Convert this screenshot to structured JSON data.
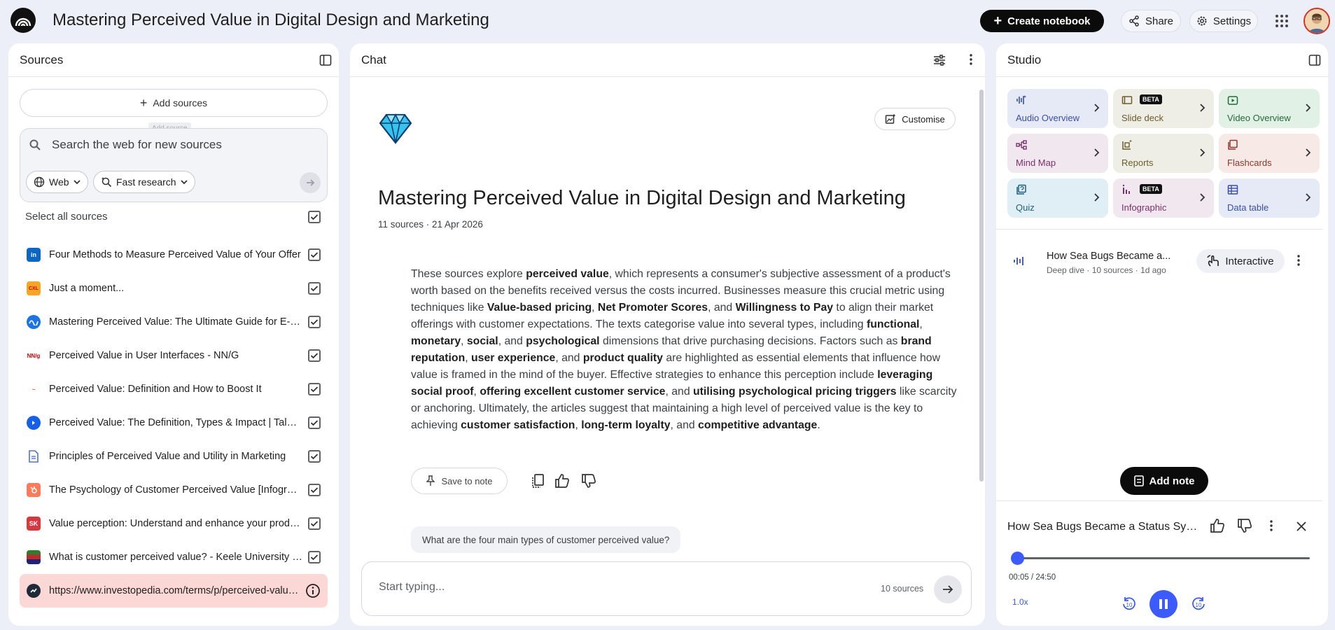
{
  "header": {
    "title": "Mastering Perceived Value in Digital Design and Marketing",
    "create_label": "Create notebook",
    "share_label": "Share",
    "settings_label": "Settings"
  },
  "sources": {
    "panel_title": "Sources",
    "add_label": "Add sources",
    "tooltip": "Add source",
    "search_placeholder": "Search the web for new sources",
    "chip_web": "Web",
    "chip_research": "Fast research",
    "select_all": "Select all sources",
    "items": [
      {
        "title": "Four Methods to Measure Perceived Value of Your Offer",
        "icon": "linkedin-icon",
        "checked": true
      },
      {
        "title": "Just a moment...",
        "icon": "cxl-icon",
        "checked": true
      },
      {
        "title": "Mastering Perceived Value: The Ultimate Guide for E-commerce",
        "icon": "wave-icon",
        "checked": true
      },
      {
        "title": "Perceived Value in User Interfaces - NN/G",
        "icon": "nng-icon",
        "checked": true
      },
      {
        "title": "Perceived Value: Definition and How to Boost It",
        "icon": "script-logo-icon",
        "checked": true
      },
      {
        "title": "Perceived Value: The Definition, Types & Impact | Talon.One",
        "icon": "talon-icon",
        "checked": true
      },
      {
        "title": "Principles of Perceived Value and Utility in Marketing",
        "icon": "document-icon",
        "checked": true
      },
      {
        "title": "The Psychology of Customer Perceived Value [Infographic]",
        "icon": "hubspot-icon",
        "checked": true
      },
      {
        "title": "Value perception: Understand and enhance your product",
        "icon": "sk-icon",
        "checked": true
      },
      {
        "title": "What is customer perceived value? - Keele University - FutureLearn",
        "icon": "keele-icon",
        "checked": true
      }
    ],
    "error_item": "https://www.investopedia.com/terms/p/perceived-value.asp"
  },
  "chat": {
    "panel_title": "Chat",
    "customise_label": "Customise",
    "notebook_title": "Mastering Perceived Value in Digital Design and Marketing",
    "meta": "11 sources · 21 Apr 2026",
    "save_label": "Save to note",
    "user_question": "What are the four main types of customer perceived value?",
    "input_placeholder": "Start typing...",
    "source_count": "10 sources"
  },
  "studio": {
    "panel_title": "Studio",
    "tiles": [
      {
        "label": "Audio Overview",
        "icon": "audio-wave-icon",
        "bg": "#e6eaf7",
        "color": "#3a4ea8"
      },
      {
        "label": "Slide deck",
        "icon": "slides-icon",
        "bg": "#efeee6",
        "color": "#6a5d2a",
        "beta": "BETA"
      },
      {
        "label": "Video Overview",
        "icon": "video-icon",
        "bg": "#e2f1e6",
        "color": "#24693a"
      },
      {
        "label": "Mind Map",
        "icon": "mindmap-icon",
        "bg": "#f1e7ef",
        "color": "#7b2f6b"
      },
      {
        "label": "Reports",
        "icon": "reports-icon",
        "bg": "#efeee6",
        "color": "#6a5d2a"
      },
      {
        "label": "Flashcards",
        "icon": "flashcards-icon",
        "bg": "#f7e9e6",
        "color": "#8a3a2a"
      },
      {
        "label": "Quiz",
        "icon": "quiz-icon",
        "bg": "#e0eff5",
        "color": "#1f6079"
      },
      {
        "label": "Infographic",
        "icon": "infographic-icon",
        "bg": "#f1e7ef",
        "color": "#7b2f6b",
        "beta": "BETA"
      },
      {
        "label": "Data table",
        "icon": "table-icon",
        "bg": "#e6eaf7",
        "color": "#3a4ea8"
      }
    ],
    "audio": {
      "title": "How Sea Bugs Became a...",
      "meta": "Deep dive · 10 sources · 1d ago",
      "interactive_label": "Interactive"
    },
    "add_note_label": "Add note",
    "player": {
      "title": "How Sea Bugs Became a Status Symbol",
      "time": "00:05 / 24:50",
      "speed": "1.0x",
      "progress": 0.0034
    }
  },
  "colors": {
    "accent": "#3b5bfd",
    "error_bg": "#fbd8d6"
  }
}
